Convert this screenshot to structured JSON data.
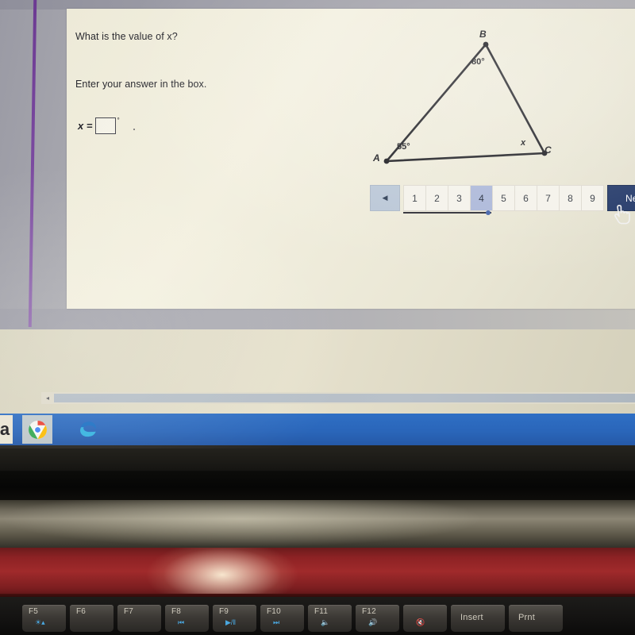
{
  "question": {
    "title": "What is the value of x?",
    "instruction": "Enter your answer in the box.",
    "x_label": "x =",
    "degree_symbol": "°",
    "answer_value": "",
    "answer_placeholder": ""
  },
  "figure": {
    "type": "triangle",
    "vertices": [
      {
        "name": "A",
        "angle": "55°"
      },
      {
        "name": "B",
        "angle": "80°"
      },
      {
        "name": "C",
        "angle": "x"
      }
    ],
    "label_A": "A",
    "label_B": "B",
    "label_C": "C",
    "angle_A": "55°",
    "angle_B": "80°",
    "angle_C": "x",
    "stroke_color": "#1a1a1f"
  },
  "pagination": {
    "prev_icon": "◀",
    "pages": [
      "1",
      "2",
      "3",
      "4",
      "5",
      "6",
      "7",
      "8",
      "9"
    ],
    "active_page": "4",
    "next_label": "Next",
    "next_icon": "▶",
    "active_color": "#aab6d8",
    "next_button_color": "#1f3566"
  },
  "scrollbar": {
    "left_arrow_icon": "◂"
  },
  "taskbar": {
    "color": "#2a66ba",
    "items": [
      {
        "name": "a-app-icon",
        "label": "a"
      },
      {
        "name": "chrome-icon",
        "label": ""
      },
      {
        "name": "edge-icon",
        "label": ""
      }
    ]
  },
  "keyboard": {
    "keys": [
      {
        "label": "F5",
        "symbol": "☀▴",
        "wide": false
      },
      {
        "label": "F6",
        "symbol": "",
        "wide": false
      },
      {
        "label": "F7",
        "symbol": "",
        "wide": false
      },
      {
        "label": "F8",
        "symbol": "⏮",
        "wide": false
      },
      {
        "label": "F9",
        "symbol": "▶/‖",
        "wide": false
      },
      {
        "label": "F10",
        "symbol": "⏭",
        "wide": false
      },
      {
        "label": "F11",
        "symbol": "🔈",
        "wide": false
      },
      {
        "label": "F12",
        "symbol": "🔊",
        "wide": false
      },
      {
        "label": "",
        "symbol": "🔇",
        "wide": false
      },
      {
        "label": "Insert",
        "symbol": "",
        "wide": true
      },
      {
        "label": "Prnt",
        "symbol": "",
        "wide": true
      }
    ]
  }
}
